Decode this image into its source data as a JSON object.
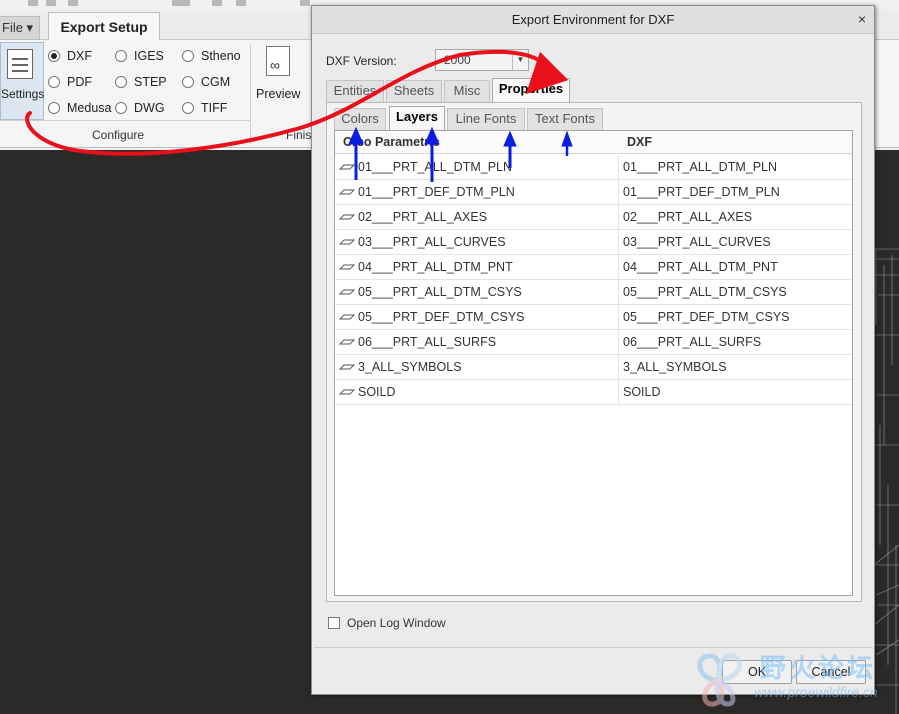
{
  "app": {
    "file_tab": "File ▾",
    "export_tab": "Export Setup",
    "settings_label": "Settings",
    "formats": [
      {
        "label": "DXF",
        "selected": true
      },
      {
        "label": "IGES",
        "selected": false
      },
      {
        "label": "Stheno",
        "selected": false
      },
      {
        "label": "PDF",
        "selected": false
      },
      {
        "label": "STEP",
        "selected": false
      },
      {
        "label": "CGM",
        "selected": false
      },
      {
        "label": "Medusa",
        "selected": false
      },
      {
        "label": "DWG",
        "selected": false
      },
      {
        "label": "TIFF",
        "selected": false
      }
    ],
    "preview_label": "Preview",
    "configure_group": "Configure",
    "finish_group": "Finis"
  },
  "dialog": {
    "title": "Export Environment for DXF",
    "close_glyph": "×",
    "version_label": "DXF Version:",
    "version_value": "2000",
    "tabs": [
      "Entities",
      "Sheets",
      "Misc",
      "Properties"
    ],
    "active_tab": "Properties",
    "subtabs": [
      "Colors",
      "Layers",
      "Line Fonts",
      "Text Fonts"
    ],
    "active_subtab": "Layers",
    "table": {
      "headers": [
        "Creo Parametric",
        "DXF"
      ],
      "rows": [
        [
          "01___PRT_ALL_DTM_PLN",
          "01___PRT_ALL_DTM_PLN"
        ],
        [
          "01___PRT_DEF_DTM_PLN",
          "01___PRT_DEF_DTM_PLN"
        ],
        [
          "02___PRT_ALL_AXES",
          "02___PRT_ALL_AXES"
        ],
        [
          "03___PRT_ALL_CURVES",
          "03___PRT_ALL_CURVES"
        ],
        [
          "04___PRT_ALL_DTM_PNT",
          "04___PRT_ALL_DTM_PNT"
        ],
        [
          "05___PRT_ALL_DTM_CSYS",
          "05___PRT_ALL_DTM_CSYS"
        ],
        [
          "05___PRT_DEF_DTM_CSYS",
          "05___PRT_DEF_DTM_CSYS"
        ],
        [
          "06___PRT_ALL_SURFS",
          "06___PRT_ALL_SURFS"
        ],
        [
          "3_ALL_SYMBOLS",
          "3_ALL_SYMBOLS"
        ],
        [
          "SOILD",
          "SOILD"
        ]
      ]
    },
    "open_log_label": "Open Log Window",
    "open_log_checked": false,
    "ok_label": "OK",
    "cancel_label": "Cancel"
  },
  "watermark": {
    "text": "野火论坛",
    "url": "www.proewildfire.cn"
  },
  "colors": {
    "annotation_red": "#e8101a",
    "annotation_blue": "#0a1de0",
    "canvas_bg": "#2b2a28"
  }
}
